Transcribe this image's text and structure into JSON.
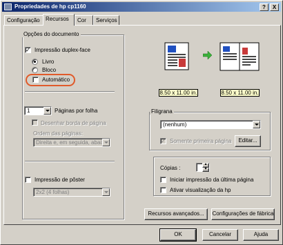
{
  "window": {
    "title": "Propriedades de hp cp1160",
    "help_btn": "?",
    "close_btn": "X"
  },
  "tabs": [
    {
      "label": "Configuração"
    },
    {
      "label": "Recursos"
    },
    {
      "label": "Cor"
    },
    {
      "label": "Serviços"
    }
  ],
  "doc_options": {
    "group_label": "Opções do documento",
    "duplex_label": "Impressão duplex-face",
    "duplex_checked": true,
    "livro_label": "Livro",
    "bloco_label": "Bloco",
    "automatico_label": "Automático",
    "pages_per_sheet_value": "1",
    "pages_per_sheet_label": "Páginas por folha",
    "draw_border_label": "Desenhar borda de página",
    "page_order_label": "Ordem das páginas:",
    "page_order_value": "Direita e, em seguida, abaixo",
    "poster_label": "Impressão de pôster",
    "poster_value": "2x2 (4 folhas)"
  },
  "preview": {
    "size_left": "8.50 x 11.00 in.",
    "size_right": "8.50 x 11.00 in."
  },
  "watermark": {
    "group_label": "Filigrana",
    "value": "(nenhum)",
    "first_page_label": "Somente primeira página",
    "edit_button": "Editar..."
  },
  "copies": {
    "label": "Cópias :",
    "value": "1",
    "last_page_first_label": "Iniciar impressão da última página",
    "hp_preview_label": "Ativar visualização da hp"
  },
  "buttons": {
    "advanced": "Recursos avançados...",
    "factory": "Configurações de fábrica",
    "ok": "OK",
    "cancel": "Cancelar",
    "help": "Ajuda"
  }
}
